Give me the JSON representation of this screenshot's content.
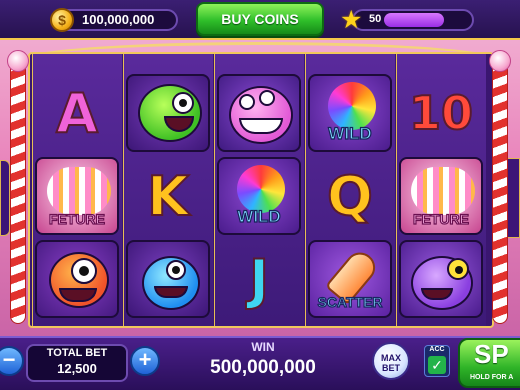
{
  "header": {
    "coin_symbol": "$",
    "coin_balance": "100,000,000",
    "buy_coins_label": "BUY COINS",
    "level": "50",
    "level_progress": 0.7
  },
  "reels": [
    {
      "symbols": [
        "A",
        "monster-green",
        "FETURE"
      ]
    },
    {
      "symbols": [
        "K",
        "monster-blue",
        ""
      ]
    },
    {
      "symbols": [
        "monster-pink",
        "WILD",
        "J"
      ]
    },
    {
      "symbols": [
        "WILD",
        "Q",
        "SCATTER"
      ]
    },
    {
      "symbols": [
        "10",
        "FETURE",
        "monster-purple"
      ]
    }
  ],
  "symbol_labels": {
    "letter_a": "A",
    "letter_k": "K",
    "letter_j": "J",
    "letter_q": "Q",
    "number_10": "10",
    "wild": "WILD",
    "feature": "FETURE",
    "scatter": "SCATTER"
  },
  "footer": {
    "minus_label": "−",
    "plus_label": "+",
    "total_bet_label": "TOTAL BET",
    "total_bet_value": "12,500",
    "win_label": "WIN",
    "win_value": "500,000,000",
    "max_bet_line1": "MAX",
    "max_bet_line2": "BET",
    "acc_label": "ACC",
    "acc_check": "✓",
    "spin_label": "SP",
    "spin_sub": "HOLD FOR A"
  },
  "colors": {
    "frame_gold": "#f1c85c",
    "reel_purple": "#3a1670",
    "buy_green": "#2fbf2a",
    "xp_purple": "#9a2ee6"
  }
}
